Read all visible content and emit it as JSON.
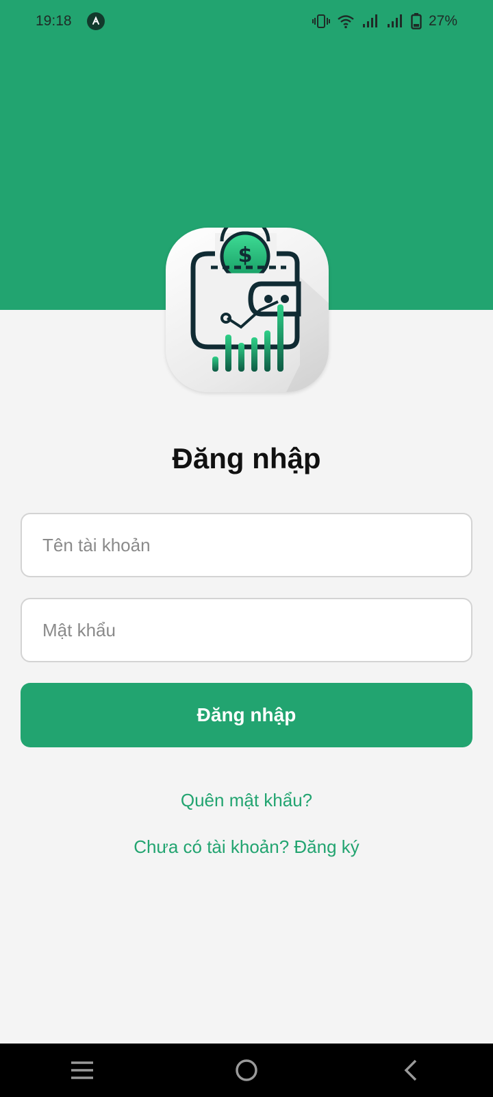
{
  "status_bar": {
    "time": "19:18",
    "battery": "27%",
    "icons": [
      "app-notification-icon",
      "vibrate-icon",
      "wifi-icon",
      "signal-icon",
      "signal-icon",
      "battery-icon"
    ]
  },
  "logo": {
    "icon": "wallet-chart-logo"
  },
  "login": {
    "title": "Đăng nhập",
    "username_placeholder": "Tên tài khoản",
    "username_value": "",
    "password_placeholder": "Mật khẩu",
    "password_value": "",
    "submit_label": "Đăng nhập",
    "forgot_label": "Quên mật khẩu?",
    "register_label": "Chưa có tài khoản? Đăng ký"
  },
  "nav_bar": {
    "icons": [
      "menu-icon",
      "home-icon",
      "back-icon"
    ]
  },
  "colors": {
    "accent": "#22a470",
    "background": "#f4f4f4",
    "nav_background": "#000000"
  }
}
